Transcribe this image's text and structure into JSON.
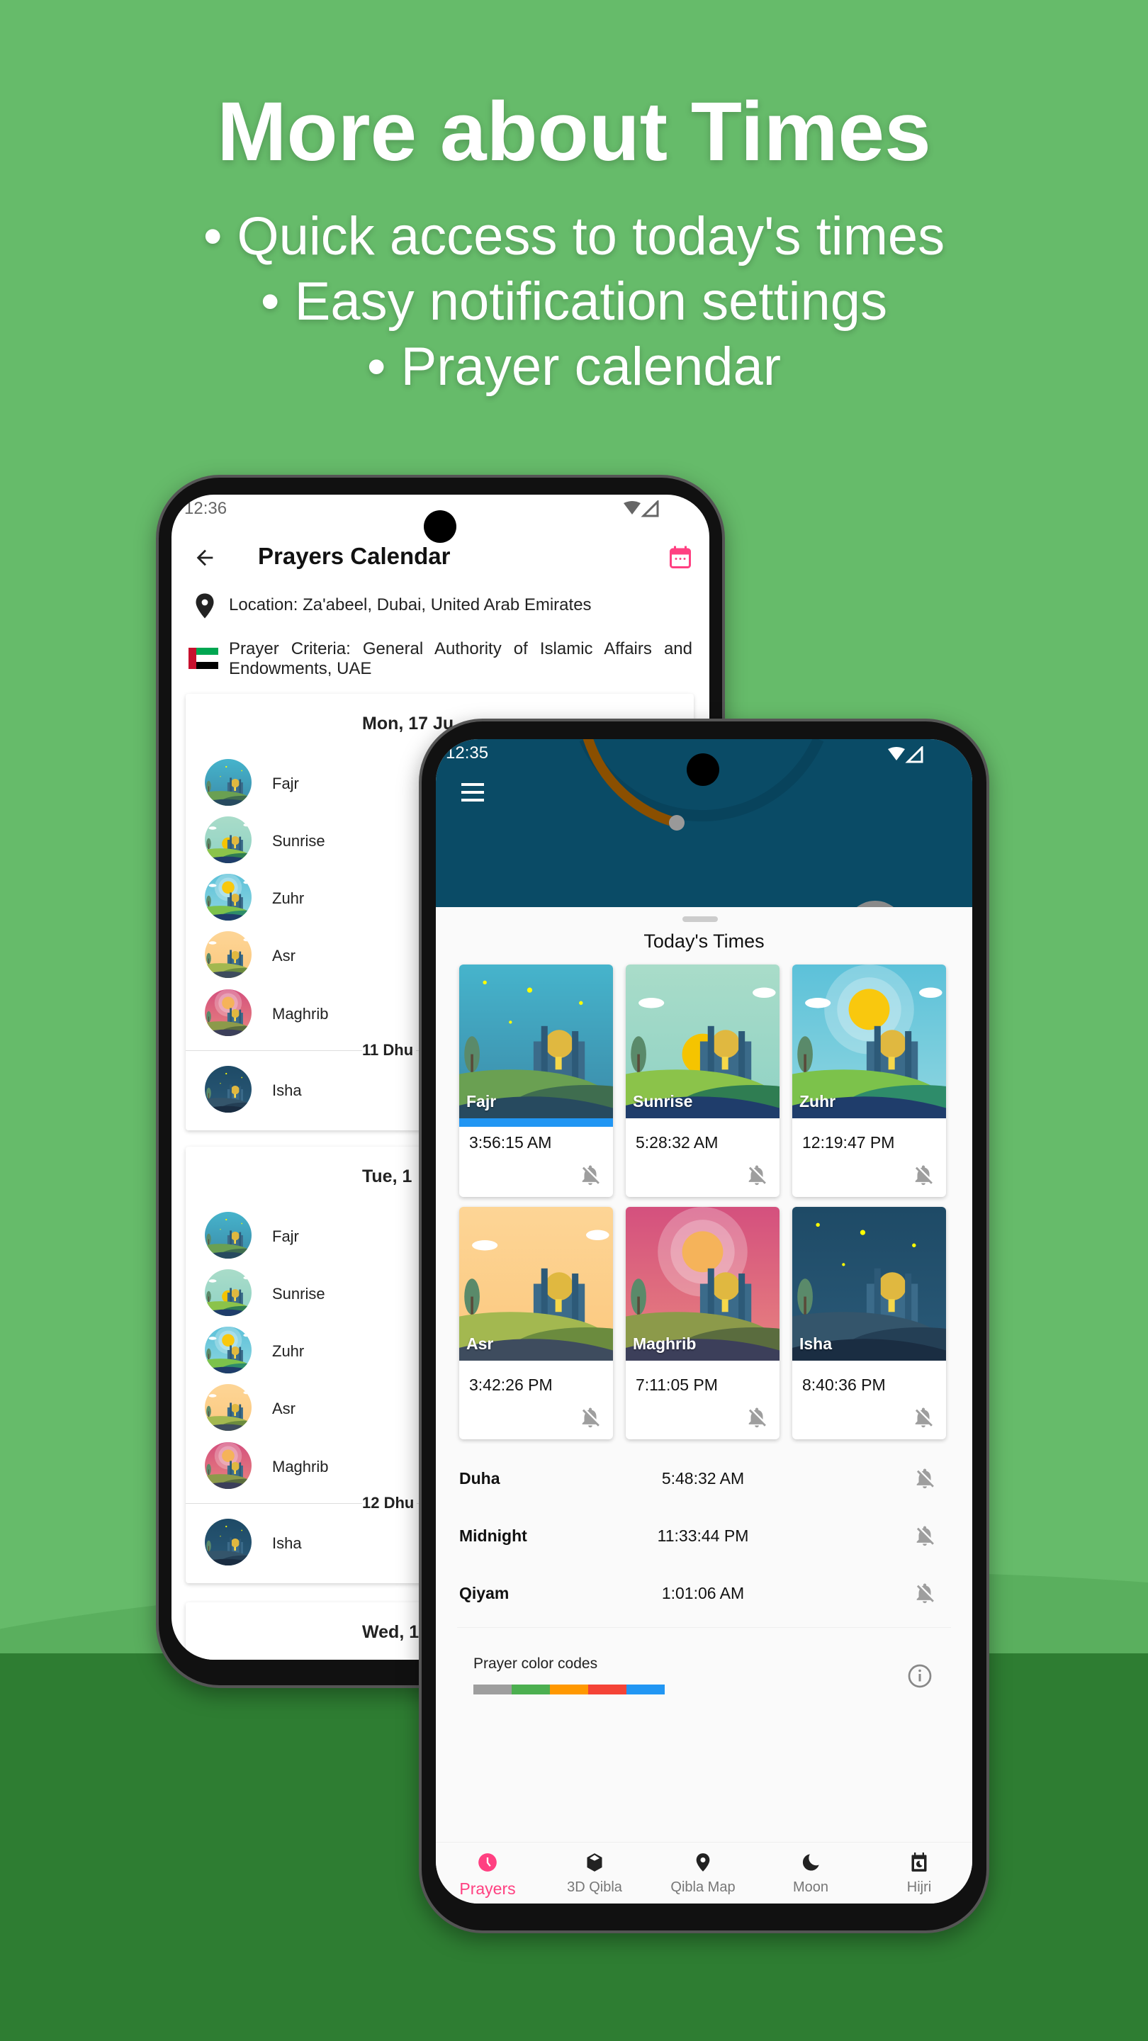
{
  "promo": {
    "headline": "More about Times",
    "bullets": [
      "• Quick access to today's times",
      "• Easy notification settings",
      "• Prayer calendar"
    ]
  },
  "back_phone": {
    "status_time": "12:36",
    "title": "Prayers Calendar",
    "location": "Location: Za'abeel, Dubai, United Arab Emirates",
    "criteria": "Prayer Criteria: General Authority of Islamic Affairs and Endowments, UAE",
    "days": [
      {
        "date": "Mon, 17 Ju",
        "hijri": "11 Dhu",
        "prayers": [
          "Fajr",
          "Sunrise",
          "Zuhr",
          "Asr",
          "Maghrib",
          "Isha"
        ]
      },
      {
        "date": "Tue, 1",
        "hijri": "12 Dhu",
        "prayers": [
          "Fajr",
          "Sunrise",
          "Zuhr",
          "Asr",
          "Maghrib",
          "Isha"
        ]
      },
      {
        "date": "Wed, 1"
      }
    ]
  },
  "front_phone": {
    "status_time": "12:35",
    "section_title": "Today's Times",
    "prayers": [
      {
        "name": "Fajr",
        "time": "3:56:15 AM",
        "scene": "fajr",
        "current": true
      },
      {
        "name": "Sunrise",
        "time": "5:28:32 AM",
        "scene": "sunrise"
      },
      {
        "name": "Zuhr",
        "time": "12:19:47 PM",
        "scene": "zuhr"
      },
      {
        "name": "Asr",
        "time": "3:42:26 PM",
        "scene": "asr"
      },
      {
        "name": "Maghrib",
        "time": "7:11:05 PM",
        "scene": "maghrib"
      },
      {
        "name": "Isha",
        "time": "8:40:36 PM",
        "scene": "isha"
      }
    ],
    "extra": [
      {
        "name": "Duha",
        "time": "5:48:32 AM"
      },
      {
        "name": "Midnight",
        "time": "11:33:44 PM"
      },
      {
        "name": "Qiyam",
        "time": "1:01:06 AM"
      }
    ],
    "color_codes": {
      "label": "Prayer color codes",
      "colors": [
        "#9e9e9e",
        "#4caf50",
        "#ff9800",
        "#f44336",
        "#2196f3"
      ]
    },
    "nav": [
      {
        "label": "Prayers",
        "icon": "clock-icon",
        "active": true
      },
      {
        "label": "3D Qibla",
        "icon": "kaaba-icon"
      },
      {
        "label": "Qibla Map",
        "icon": "map-pin-icon"
      },
      {
        "label": "Moon",
        "icon": "moon-icon"
      },
      {
        "label": "Hijri",
        "icon": "hijri-calendar-icon"
      }
    ]
  },
  "colors": {
    "accent": "#ff4081",
    "header": "#0a4b66",
    "background": "#66bb6a",
    "background_dark": "#2e7d32",
    "progress": "#2196f3",
    "arc": "#8a4f00"
  }
}
